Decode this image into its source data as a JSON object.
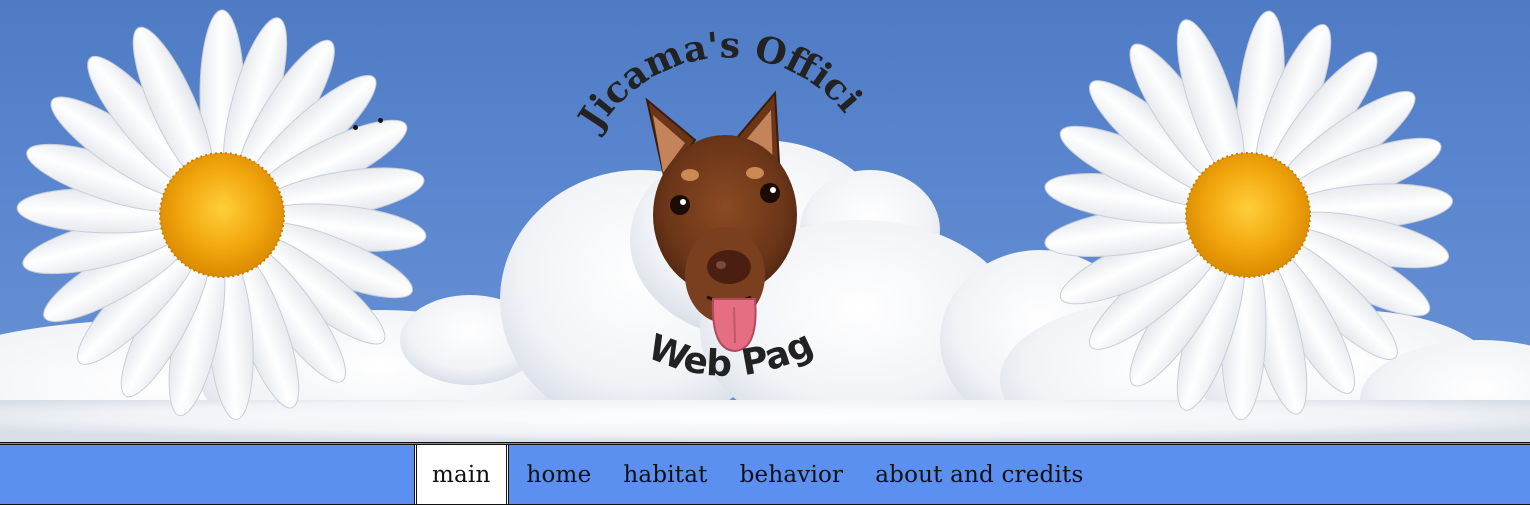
{
  "banner": {
    "arc_top_text": "Jicama's Official",
    "arc_bottom_text": "Web Page"
  },
  "nav": {
    "items": [
      {
        "label": "main",
        "active": true
      },
      {
        "label": "home",
        "active": false
      },
      {
        "label": "habitat",
        "active": false
      },
      {
        "label": "behavior",
        "active": false
      },
      {
        "label": "about and credits",
        "active": false
      }
    ]
  },
  "colors": {
    "sky": "#5a86cf",
    "nav_bar": "#5b8ff0",
    "daisy_center": "#f2a60d",
    "petal": "#ffffff"
  },
  "icons": {
    "left_flower": "daisy-icon",
    "right_flower": "daisy-icon",
    "mascot": "dog-head-icon"
  }
}
